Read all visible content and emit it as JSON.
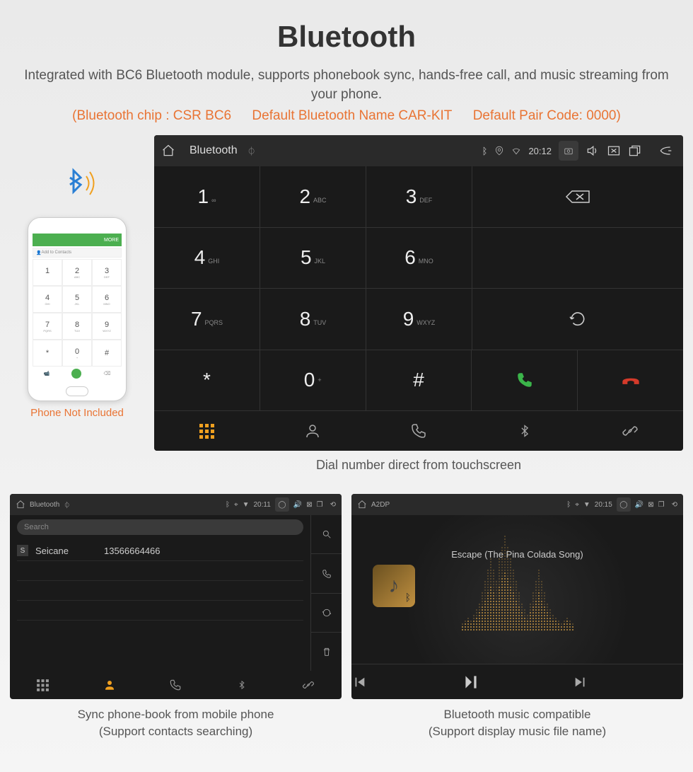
{
  "title": "Bluetooth",
  "subtitle": "Integrated with BC6 Bluetooth module, supports phonebook sync, hands-free call, and music streaming from your phone.",
  "specs": {
    "chip": "(Bluetooth chip : CSR BC6",
    "name": "Default Bluetooth Name CAR-KIT",
    "code": "Default Pair Code: 0000)"
  },
  "phone_caption": "Phone Not Included",
  "phone_add": "Add to Contacts",
  "phone_more": "MORE",
  "main_screen": {
    "title": "Bluetooth",
    "time": "20:12",
    "keys": [
      {
        "num": "1",
        "let": "∞"
      },
      {
        "num": "2",
        "let": "ABC"
      },
      {
        "num": "3",
        "let": "DEF"
      },
      {
        "num": "4",
        "let": "GHI"
      },
      {
        "num": "5",
        "let": "JKL"
      },
      {
        "num": "6",
        "let": "MNO"
      },
      {
        "num": "7",
        "let": "PQRS"
      },
      {
        "num": "8",
        "let": "TUV"
      },
      {
        "num": "9",
        "let": "WXYZ"
      },
      {
        "num": "*",
        "let": ""
      },
      {
        "num": "0",
        "let": "+"
      },
      {
        "num": "#",
        "let": ""
      }
    ],
    "caption": "Dial number direct from touchscreen"
  },
  "phonebook": {
    "title": "Bluetooth",
    "time": "20:11",
    "search": "Search",
    "contact": {
      "letter": "S",
      "name": "Seicane",
      "number": "13566664466"
    },
    "caption_l1": "Sync phone-book from mobile phone",
    "caption_l2": "(Support contacts searching)"
  },
  "music": {
    "title": "A2DP",
    "time": "20:15",
    "song": "Escape (The Pina Colada Song)",
    "caption_l1": "Bluetooth music compatible",
    "caption_l2": "(Support display music file name)"
  }
}
